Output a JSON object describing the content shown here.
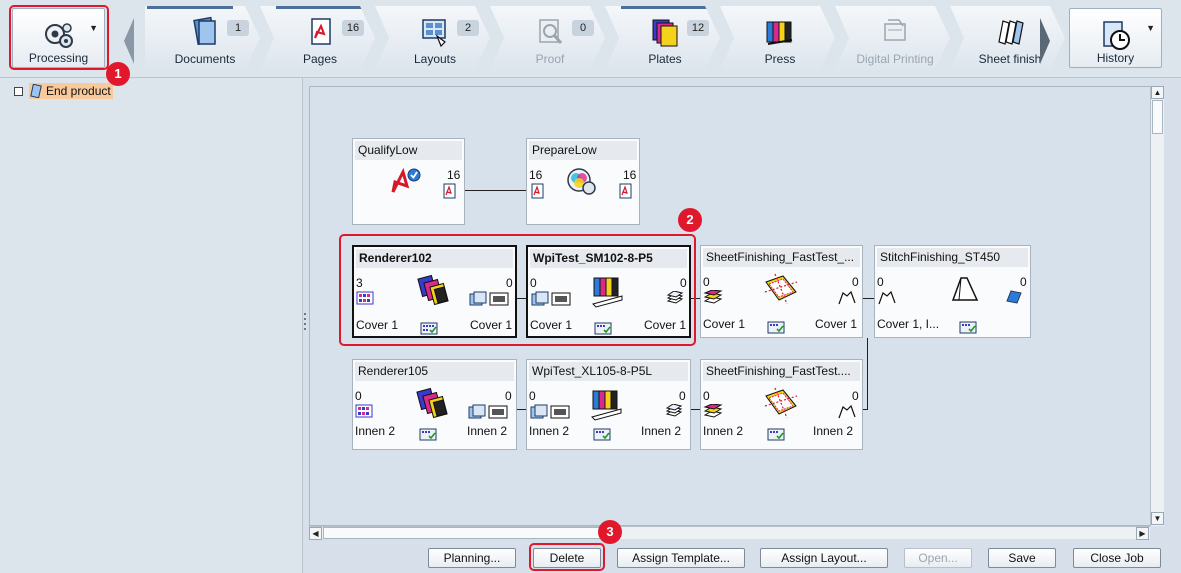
{
  "toolbar": {
    "processing_label": "Processing",
    "history_label": "History",
    "tabs": [
      {
        "label": "Documents",
        "count": "1",
        "icon": "documents-icon",
        "disabled": false
      },
      {
        "label": "Pages",
        "count": "16",
        "icon": "pages-icon",
        "disabled": false
      },
      {
        "label": "Layouts",
        "count": "2",
        "icon": "layouts-icon",
        "disabled": false
      },
      {
        "label": "Proof",
        "count": "0",
        "icon": "proof-icon",
        "disabled": true
      },
      {
        "label": "Plates",
        "count": "12",
        "icon": "plates-icon",
        "disabled": false
      },
      {
        "label": "Press",
        "count": "",
        "icon": "press-icon",
        "disabled": false
      },
      {
        "label": "Digital Printing",
        "count": "",
        "icon": "digital-printing-icon",
        "disabled": true
      },
      {
        "label": "Sheet finish",
        "count": "",
        "icon": "sheet-finish-icon",
        "disabled": false
      }
    ]
  },
  "tree": {
    "item_label": "End product"
  },
  "graph": {
    "qualify": {
      "title": "QualifyLow",
      "count": "16"
    },
    "prepare": {
      "title": "PrepareLow",
      "in_count": "16",
      "out_count": "16"
    },
    "renderer102": {
      "title": "Renderer102",
      "in_count": "3",
      "out_count": "0",
      "in_label": "Cover 1",
      "out_label": "Cover 1"
    },
    "wpi_sm102": {
      "title": "WpiTest_SM102-8-P5",
      "in_count": "0",
      "out_count": "0",
      "in_label": "Cover 1",
      "out_label": "Cover 1"
    },
    "sheetfin1": {
      "title": "SheetFinishing_FastTest_...",
      "in_count": "0",
      "out_count": "0",
      "in_label": "Cover 1",
      "out_label": "Cover 1"
    },
    "stitch": {
      "title": "StitchFinishing_ST450",
      "in_count": "0",
      "out_count": "0",
      "in_label": "Cover 1, I..."
    },
    "renderer105": {
      "title": "Renderer105",
      "in_count": "0",
      "out_count": "0",
      "in_label": "Innen 2",
      "out_label": "Innen 2"
    },
    "wpi_xl105": {
      "title": "WpiTest_XL105-8-P5L",
      "in_count": "0",
      "out_count": "0",
      "in_label": "Innen 2",
      "out_label": "Innen 2"
    },
    "sheetfin2": {
      "title": "SheetFinishing_FastTest....",
      "in_count": "0",
      "out_count": "0",
      "in_label": "Innen 2",
      "out_label": "Innen 2"
    }
  },
  "badges": [
    "1",
    "2",
    "3"
  ],
  "buttons": {
    "planning": "Planning...",
    "delete": "Delete",
    "assign_template": "Assign Template...",
    "assign_layout": "Assign Layout...",
    "open": "Open...",
    "save": "Save",
    "close_job": "Close Job"
  },
  "colors": {
    "highlight": "#e0182c",
    "selected_tree": "#f8c99a",
    "tab_accent": "#4d6f9a"
  }
}
